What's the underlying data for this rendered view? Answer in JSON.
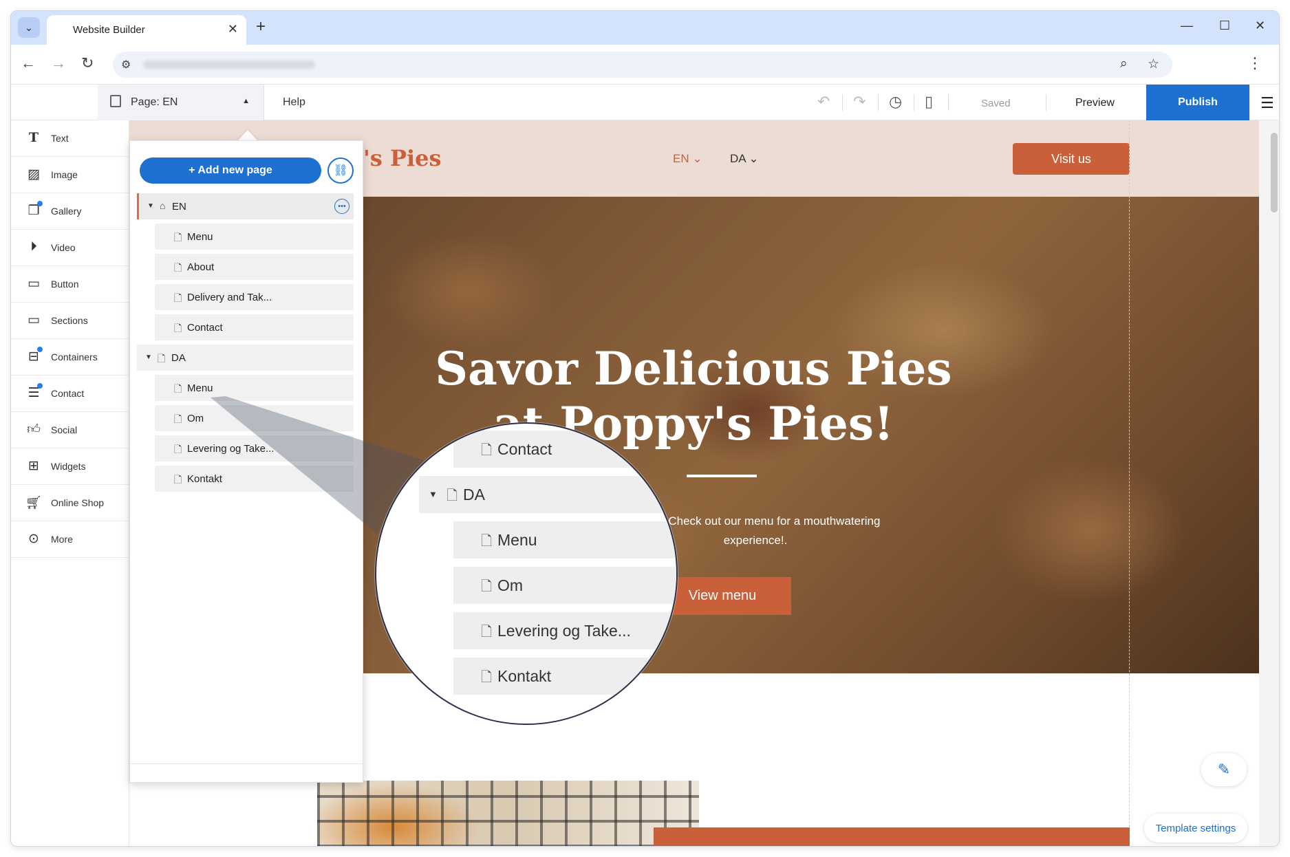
{
  "browser": {
    "tab_title": "Website Builder",
    "tab_close": "✕",
    "new_tab": "+",
    "tab_menu": "⌄"
  },
  "toolbar": {
    "page_label": "Page: EN",
    "help": "Help",
    "saved": "Saved",
    "preview": "Preview",
    "publish": "Publish"
  },
  "left_panel": {
    "items": [
      {
        "label": "Text",
        "icon": "text-icon"
      },
      {
        "label": "Image",
        "icon": "image-icon"
      },
      {
        "label": "Gallery",
        "icon": "gallery-icon"
      },
      {
        "label": "Video",
        "icon": "video-icon"
      },
      {
        "label": "Button",
        "icon": "button-icon"
      },
      {
        "label": "Sections",
        "icon": "sections-icon"
      },
      {
        "label": "Containers",
        "icon": "containers-icon"
      },
      {
        "label": "Contact",
        "icon": "contact-icon"
      },
      {
        "label": "Social",
        "icon": "social-icon"
      },
      {
        "label": "Widgets",
        "icon": "widgets-icon"
      },
      {
        "label": "Online Shop",
        "icon": "cart-icon"
      },
      {
        "label": "More",
        "icon": "more-icon"
      }
    ]
  },
  "pages_dropdown": {
    "add_button": "+ Add new page",
    "en": {
      "label": "EN",
      "pages": [
        "Menu",
        "About",
        "Delivery and Tak...",
        "Contact"
      ]
    },
    "da": {
      "label": "DA",
      "pages": [
        "Menu",
        "Om",
        "Levering og Take...",
        "Kontakt"
      ]
    }
  },
  "site": {
    "logo": "'s Pies",
    "lang_en": "EN",
    "lang_da": "DA",
    "visit_button": "Visit us",
    "hero_title": "Savor Delicious Pies at Poppy's Pies!",
    "hero_text_line1": "ection. Check out our menu for a mouthwatering",
    "hero_text_line2": "experience!.",
    "hero_button": "View menu",
    "template_settings": "Template settings"
  },
  "magnifier": {
    "rows": [
      "Contact",
      "DA",
      "Menu",
      "Om",
      "Levering og Take...",
      "Kontakt"
    ]
  },
  "colors": {
    "accent": "#1d6fd0",
    "brand": "#c9603a",
    "active_marker": "#e4674a"
  }
}
